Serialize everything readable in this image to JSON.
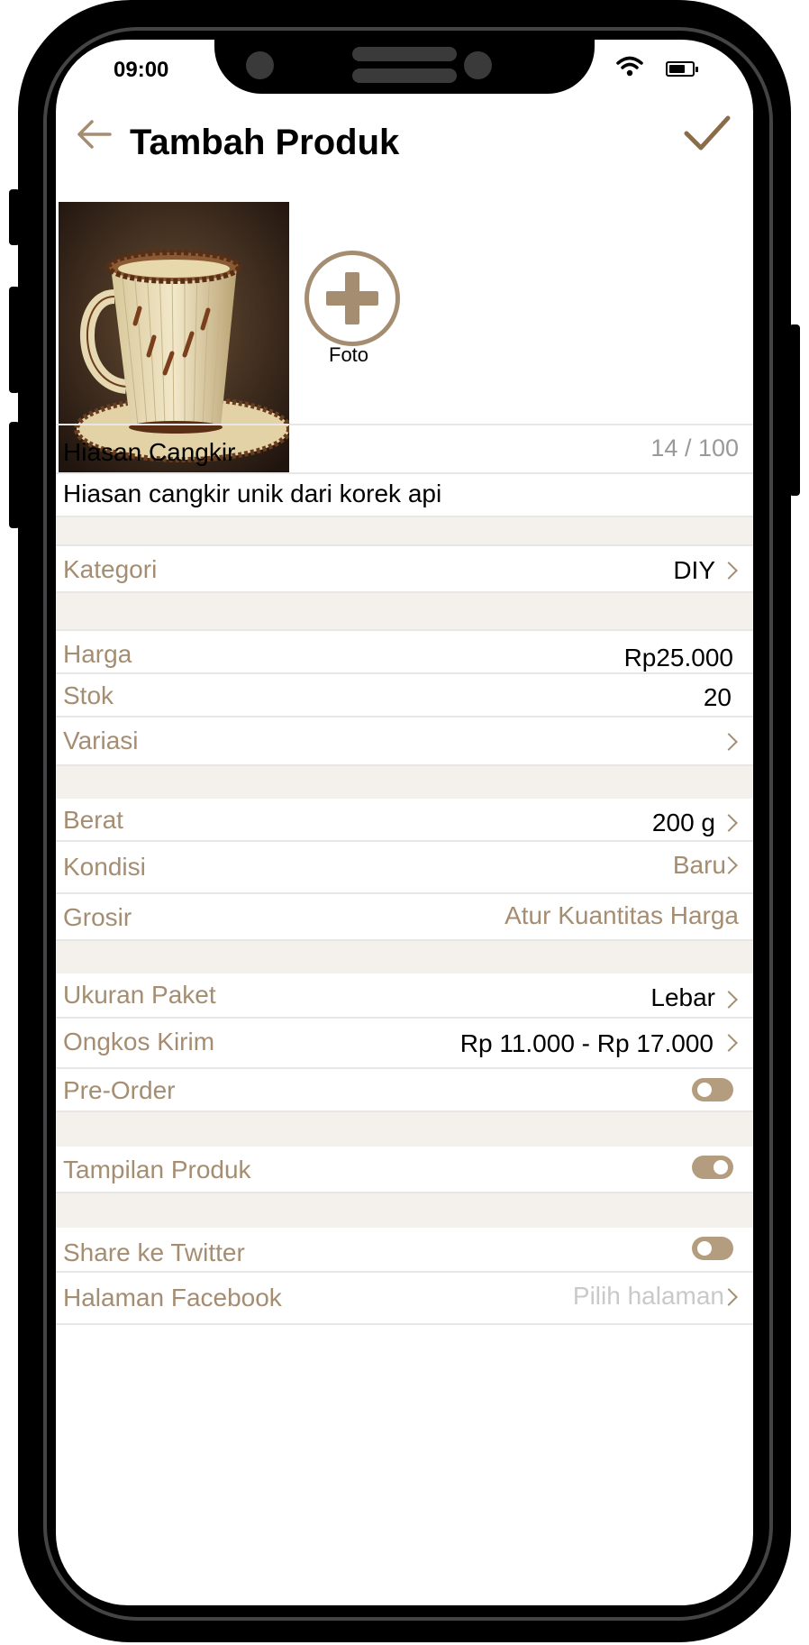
{
  "status_bar": {
    "time": "09:00",
    "battery_level": 0.7
  },
  "header": {
    "title": "Tambah Produk",
    "back_icon": "arrow-left-icon",
    "confirm_icon": "check-icon"
  },
  "photos": {
    "add_label": "Foto",
    "thumbnail_alt": "Hiasan cangkir dari korek api"
  },
  "product": {
    "name": "Hiasan Cangkir",
    "name_counter": "14 / 100",
    "description": "Hiasan cangkir unik dari korek api"
  },
  "fields": {
    "kategori": {
      "label": "Kategori",
      "value": "DIY"
    },
    "harga": {
      "label": "Harga",
      "value": "Rp25.000"
    },
    "stok": {
      "label": "Stok",
      "value": "20"
    },
    "variasi": {
      "label": "Variasi"
    },
    "berat": {
      "label": "Berat",
      "value": "200 g"
    },
    "kondisi": {
      "label": "Kondisi",
      "value": "Baru"
    },
    "grosir": {
      "label": "Grosir",
      "value": "Atur Kuantitas Harga"
    },
    "ukuran_paket": {
      "label": "Ukuran Paket",
      "value": "Lebar"
    },
    "ongkos_kirim": {
      "label": "Ongkos Kirim",
      "value": "Rp 11.000 - Rp 17.000"
    },
    "pre_order": {
      "label": "Pre-Order",
      "enabled": false
    },
    "tampilan_produk": {
      "label": "Tampilan Produk",
      "enabled": true
    },
    "share_twitter": {
      "label": "Share ke Twitter",
      "enabled": false
    },
    "halaman_facebook": {
      "label": "Halaman Facebook",
      "placeholder": "Pilih halaman"
    }
  },
  "colors": {
    "accent": "#a58d72",
    "section_gap": "#f4f1ec",
    "toggle": "#b49d7e"
  }
}
